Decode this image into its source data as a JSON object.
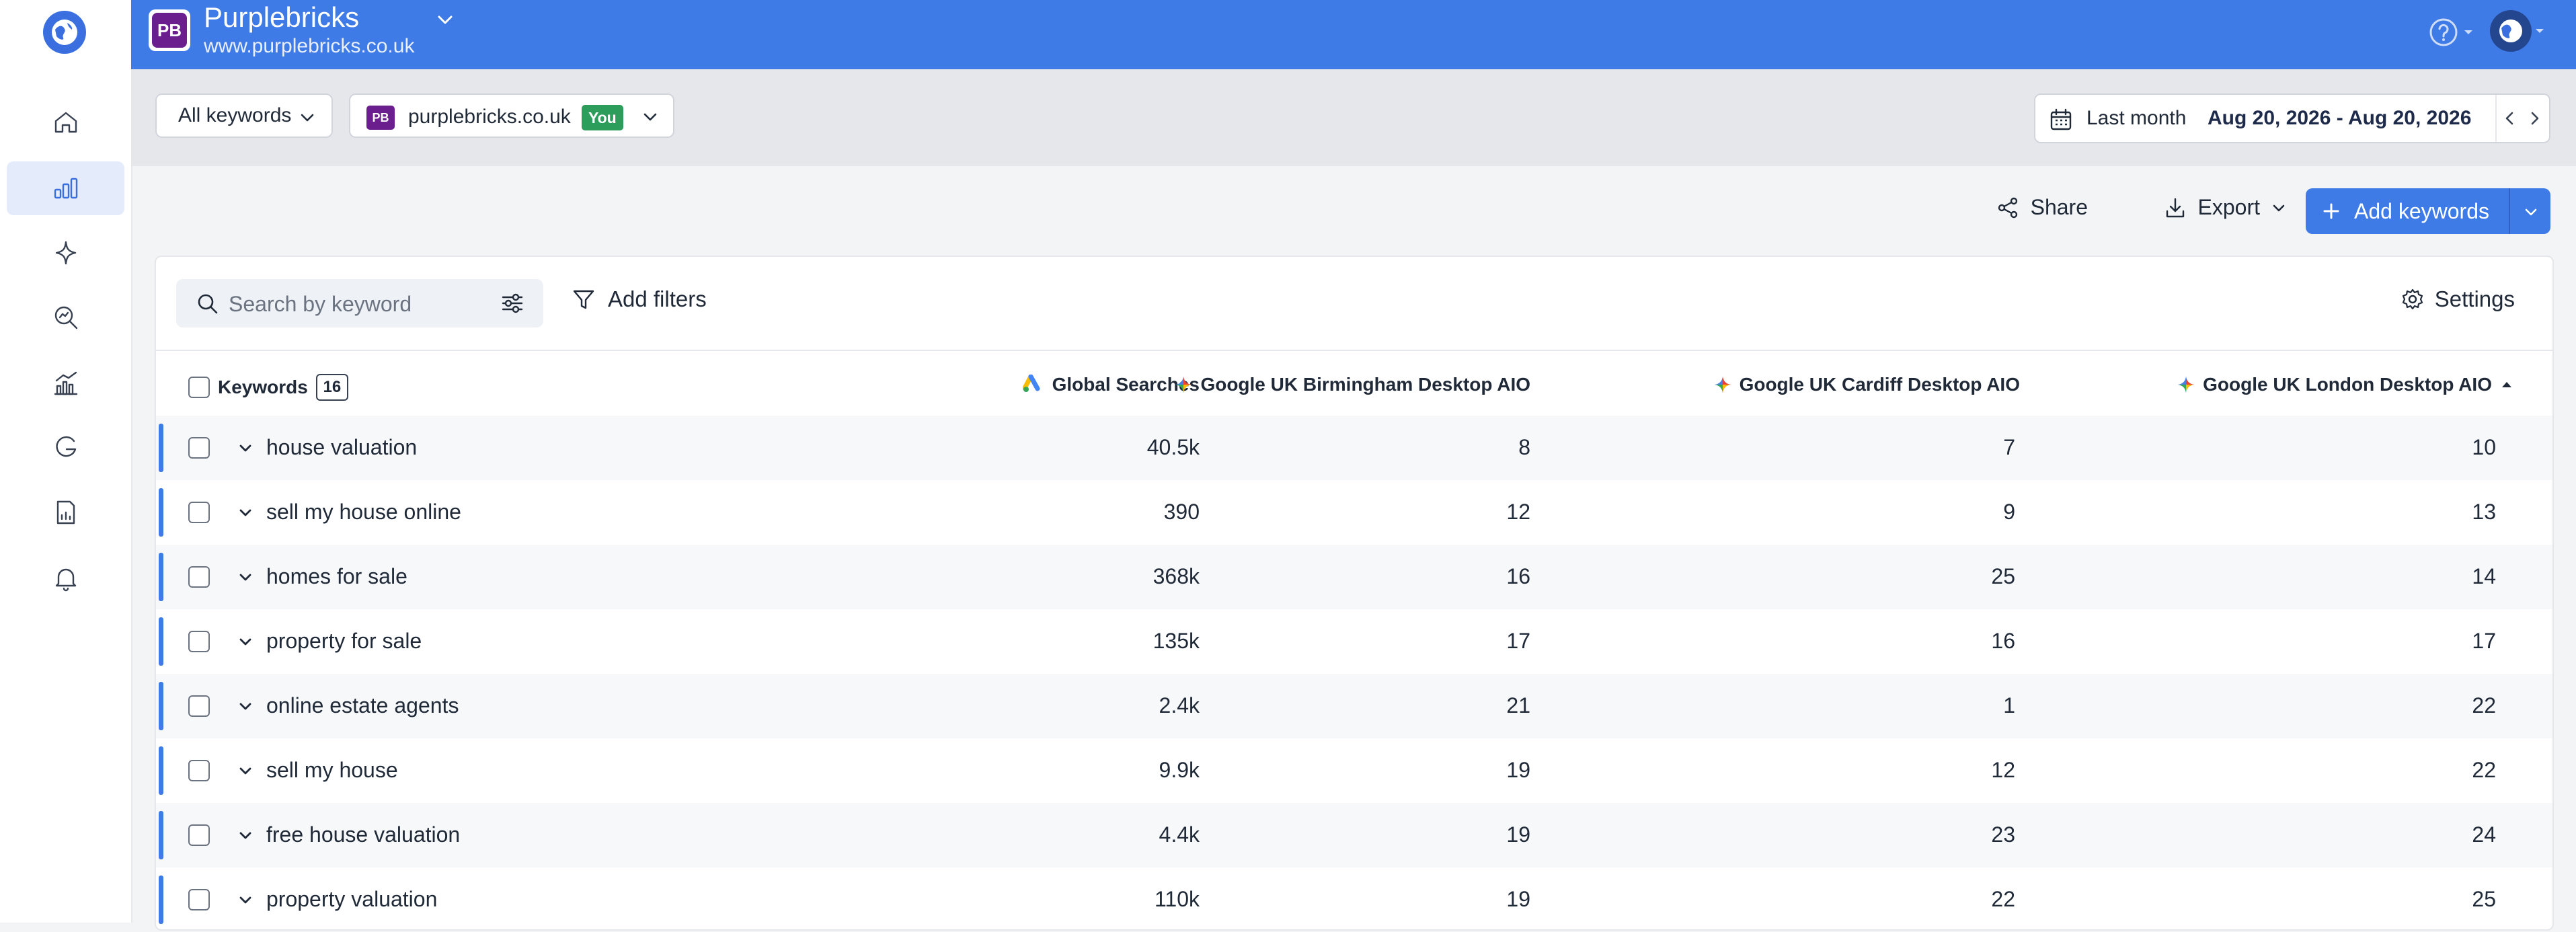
{
  "colors": {
    "accent": "#3f7be6",
    "brand_purple": "#6b1f8e",
    "you_badge": "#2d9d5c"
  },
  "rail": {
    "items": [
      {
        "icon": "home-icon"
      },
      {
        "icon": "bar-chart-icon",
        "active": true
      },
      {
        "icon": "sparkle-icon"
      },
      {
        "icon": "search-analytics-icon"
      },
      {
        "icon": "trend-chart-icon"
      },
      {
        "icon": "google-g-icon"
      },
      {
        "icon": "report-icon"
      },
      {
        "icon": "bell-icon"
      }
    ]
  },
  "header": {
    "badge": "PB",
    "site_name": "Purplebricks",
    "site_url": "www.purplebricks.co.uk"
  },
  "toolbar": {
    "keyword_filter": "All keywords",
    "competitor_badge": "PB",
    "competitor_domain": "purplebricks.co.uk",
    "you_label": "You",
    "date_range_label": "Last month",
    "date_range_value": "Aug 20, 2026 - Aug 20, 2026"
  },
  "actions": {
    "share": "Share",
    "export": "Export",
    "add_keywords": "Add keywords"
  },
  "table_controls": {
    "search_placeholder": "Search by keyword",
    "add_filters": "Add filters",
    "settings": "Settings"
  },
  "table": {
    "keywords_header": "Keywords",
    "keyword_count": "16",
    "columns": [
      "Global Searches",
      "Google UK Birmingham Desktop AIO",
      "Google UK Cardiff Desktop AIO",
      "Google UK London Desktop AIO"
    ],
    "rows": [
      {
        "keyword": "house valuation",
        "global": "40.5k",
        "birmingham": "8",
        "cardiff": "7",
        "london": "10"
      },
      {
        "keyword": "sell my house online",
        "global": "390",
        "birmingham": "12",
        "cardiff": "9",
        "london": "13"
      },
      {
        "keyword": "homes for sale",
        "global": "368k",
        "birmingham": "16",
        "cardiff": "25",
        "london": "14"
      },
      {
        "keyword": "property for sale",
        "global": "135k",
        "birmingham": "17",
        "cardiff": "16",
        "london": "17"
      },
      {
        "keyword": "online estate agents",
        "global": "2.4k",
        "birmingham": "21",
        "cardiff": "1",
        "london": "22"
      },
      {
        "keyword": "sell my house",
        "global": "9.9k",
        "birmingham": "19",
        "cardiff": "12",
        "london": "22"
      },
      {
        "keyword": "free house valuation",
        "global": "4.4k",
        "birmingham": "19",
        "cardiff": "23",
        "london": "24"
      },
      {
        "keyword": "property valuation",
        "global": "110k",
        "birmingham": "19",
        "cardiff": "22",
        "london": "25"
      }
    ]
  }
}
